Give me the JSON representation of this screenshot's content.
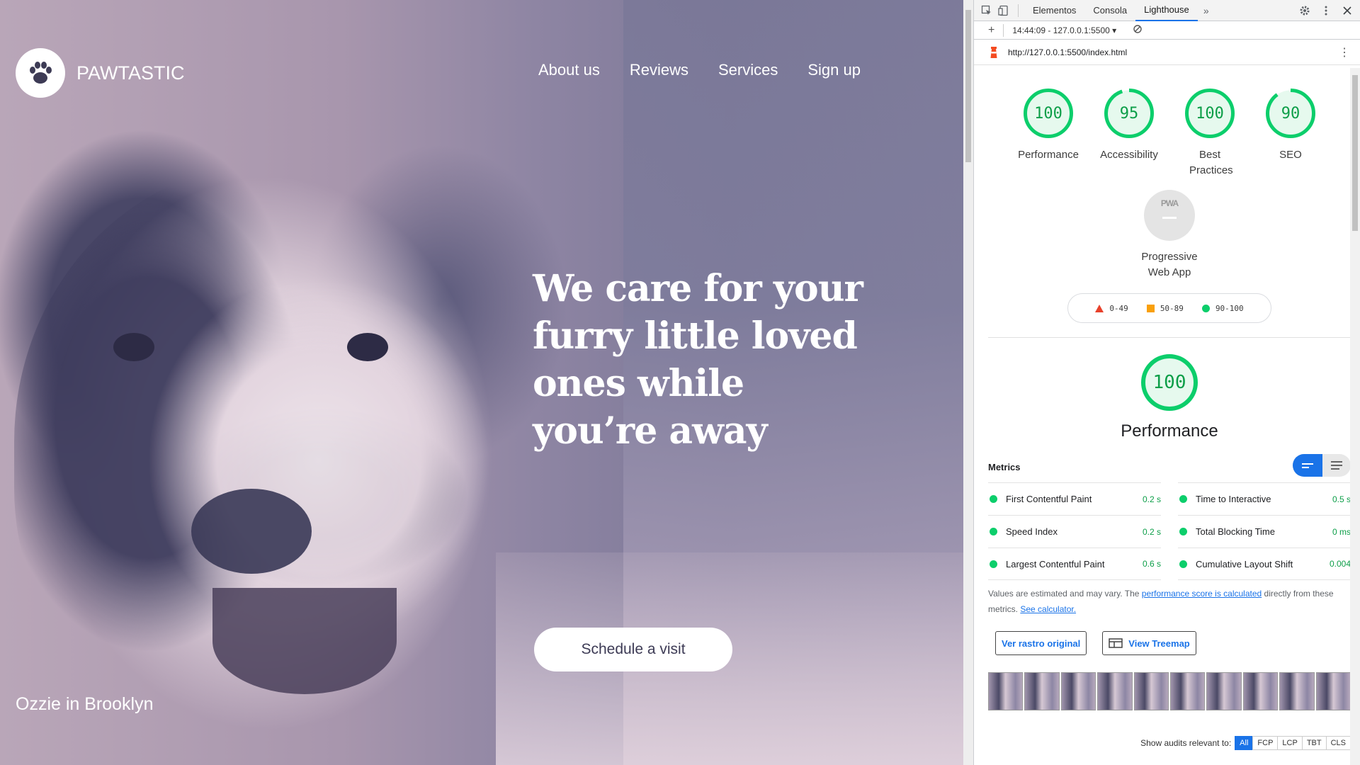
{
  "site": {
    "brand": "PAWTASTIC",
    "nav": [
      "About us",
      "Reviews",
      "Services",
      "Sign up"
    ],
    "hero_lines": [
      "We care for your",
      "furry little loved",
      "ones while",
      "you’re away"
    ],
    "cta": "Schedule a visit",
    "caption": "Ozzie in Brooklyn"
  },
  "devtools": {
    "tabs": [
      "Elementos",
      "Consola",
      "Lighthouse"
    ],
    "active_tab": "Lighthouse",
    "more": "»",
    "session": "14:44:09 - 127.0.0.1:5500",
    "url": "http://127.0.0.1:5500/index.html",
    "gauges": [
      {
        "score": "100",
        "label": "Performance",
        "value": 100
      },
      {
        "score": "95",
        "label": "Accessibility",
        "value": 95
      },
      {
        "score": "100",
        "label": "Best Practices",
        "value": 100
      },
      {
        "score": "90",
        "label": "SEO",
        "value": 90
      }
    ],
    "pwa": {
      "badge": "PWA",
      "label": "Progressive Web App"
    },
    "legend": [
      "0-49",
      "50-89",
      "90-100"
    ],
    "perf": {
      "score": "100",
      "title": "Performance"
    },
    "metrics_title": "Metrics",
    "metrics": [
      {
        "name": "First Contentful Paint",
        "value": "0.2 s"
      },
      {
        "name": "Time to Interactive",
        "value": "0.5 s"
      },
      {
        "name": "Speed Index",
        "value": "0.2 s"
      },
      {
        "name": "Total Blocking Time",
        "value": "0 ms"
      },
      {
        "name": "Largest Contentful Paint",
        "value": "0.6 s"
      },
      {
        "name": "Cumulative Layout Shift",
        "value": "0.004"
      }
    ],
    "note_pre": "Values are estimated and may vary. The ",
    "note_link1": "performance score is calculated",
    "note_mid": " directly from these metrics. ",
    "note_link2": "See calculator.",
    "btn_trace": "Ver rastro original",
    "btn_treemap": "View Treemap",
    "audits_label": "Show audits relevant to:",
    "chips": [
      "All",
      "FCP",
      "LCP",
      "TBT",
      "CLS"
    ],
    "colors": {
      "pass": "#0cce6b",
      "average": "#f9a00b",
      "fail": "#e8412b",
      "accent": "#1a73e8"
    }
  }
}
